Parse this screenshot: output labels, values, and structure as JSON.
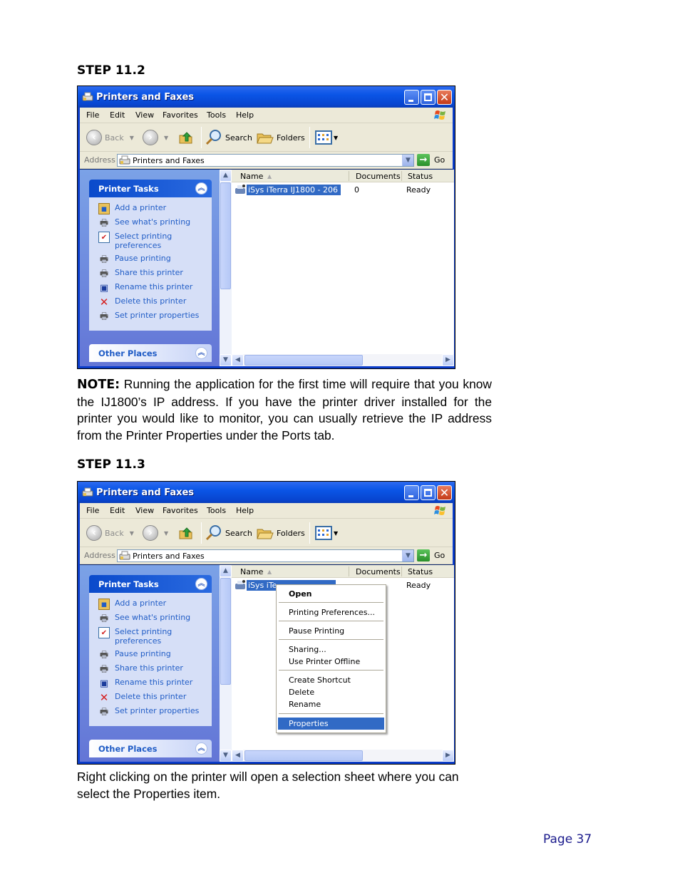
{
  "step_a": "STEP 11.2",
  "step_b": "STEP 11.3",
  "note": {
    "label": "NOTE:",
    "text": "  Running the application for the first time will require that you know the IJ1800’s IP address.  If you have the printer driver installed for the printer you would like to monitor, you can usually retrieve the IP address from the Printer Properties under the Ports tab."
  },
  "caption": "Right clicking on the printer will open a selection sheet where you can select the Properties item.",
  "page_number": "Page 37",
  "window": {
    "title": "Printers and Faxes",
    "close_glyph": "✕",
    "menu": [
      "File",
      "Edit",
      "View",
      "Favorites",
      "Tools",
      "Help"
    ],
    "toolbar": {
      "back": "Back",
      "search": "Search",
      "folders": "Folders"
    },
    "address": {
      "label": "Address",
      "value": "Printers and Faxes",
      "go": "Go"
    },
    "printer_tasks": {
      "title": "Printer Tasks",
      "items": [
        {
          "label": "Add a printer",
          "icon": "add-printer-icon"
        },
        {
          "label": "See what's printing",
          "icon": "print-queue-icon"
        },
        {
          "label": "Select printing\npreferences",
          "line1": "Select printing",
          "line2": "preferences",
          "icon": "preferences-icon"
        },
        {
          "label": "Pause printing",
          "icon": "pause-printer-icon"
        },
        {
          "label": "Share this printer",
          "icon": "share-printer-icon"
        },
        {
          "label": "Rename this printer",
          "icon": "rename-icon"
        },
        {
          "label": "Delete this printer",
          "icon": "delete-icon"
        },
        {
          "label": "Set printer properties",
          "icon": "properties-icon"
        }
      ]
    },
    "other_places": {
      "title": "Other Places"
    },
    "list": {
      "columns": [
        "Name",
        "Documents",
        "Status"
      ],
      "rows": [
        {
          "name": "iSys iTerra IJ1800 - 206",
          "name_truncated": "iSys iTe",
          "documents": "0",
          "status": "Ready"
        }
      ]
    }
  },
  "context_menu": {
    "items": [
      {
        "label": "Open",
        "bold": true
      },
      {
        "label": "Printing Preferences..."
      },
      {
        "label": "Pause Printing"
      },
      {
        "label": "Sharing..."
      },
      {
        "label": "Use Printer Offline"
      },
      {
        "label": "Create Shortcut"
      },
      {
        "label": "Delete"
      },
      {
        "label": "Rename"
      },
      {
        "label": "Properties",
        "selected": true
      }
    ],
    "selection_color": "#316ac5"
  }
}
